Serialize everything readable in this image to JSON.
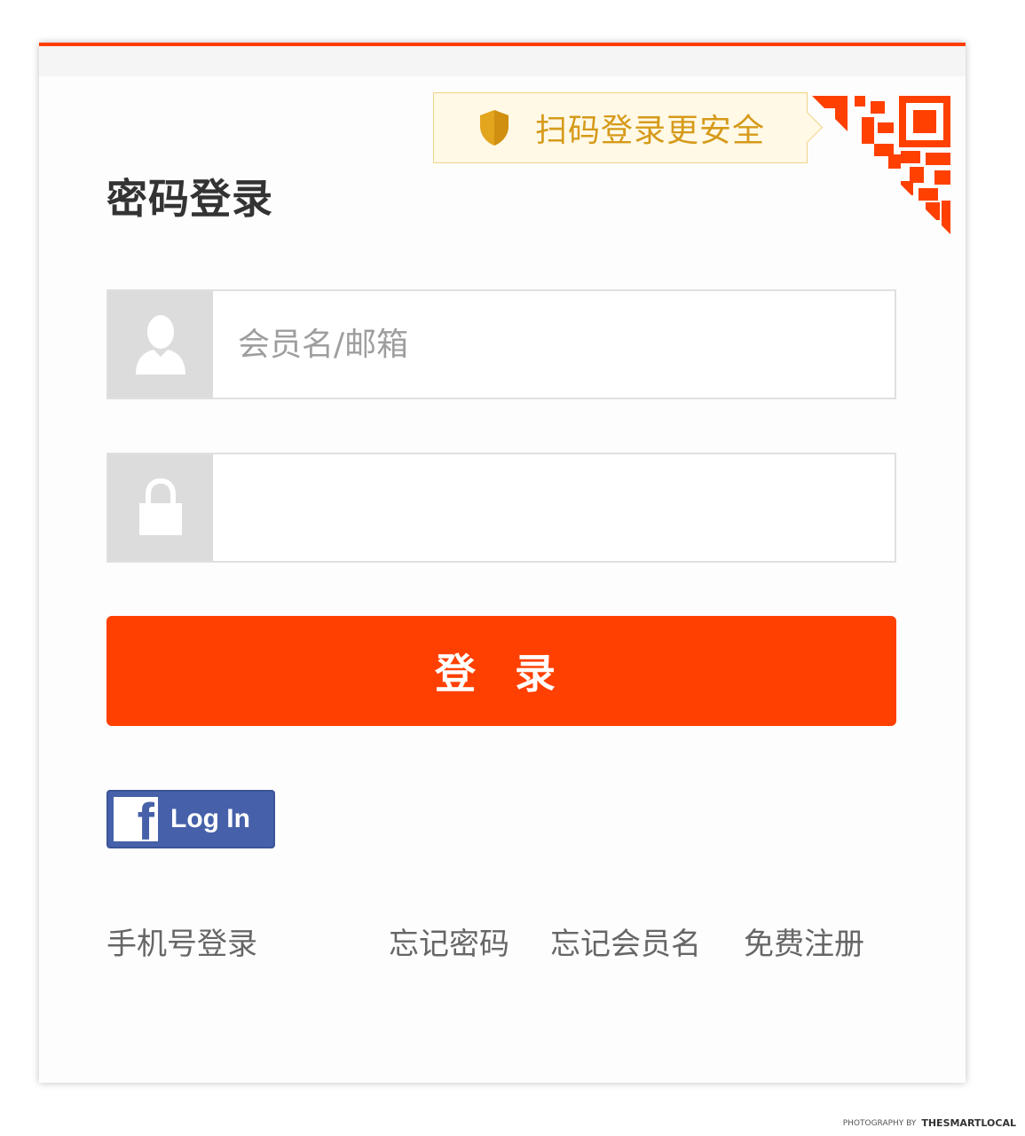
{
  "tooltip": {
    "text": "扫码登录更安全",
    "icon": "shield-icon"
  },
  "qr": {
    "icon": "qr-code-icon"
  },
  "login": {
    "title": "密码登录",
    "username_placeholder": "会员名/邮箱",
    "username_icon": "user-icon",
    "password_icon": "lock-icon",
    "password_value": "",
    "submit_label": "登 录"
  },
  "facebook": {
    "label": "Log In",
    "icon": "facebook-icon"
  },
  "links": {
    "phone_login": "手机号登录",
    "forgot_password": "忘记密码",
    "forgot_member_name": "忘记会员名",
    "register": "免费注册"
  },
  "credit": {
    "prefix": "PHOTOGRAPHY BY",
    "brand": "THESMARTLOCAL"
  },
  "colors": {
    "accent": "#ff4000",
    "tooltip_text": "#d69a1a",
    "facebook": "#4661a9"
  }
}
